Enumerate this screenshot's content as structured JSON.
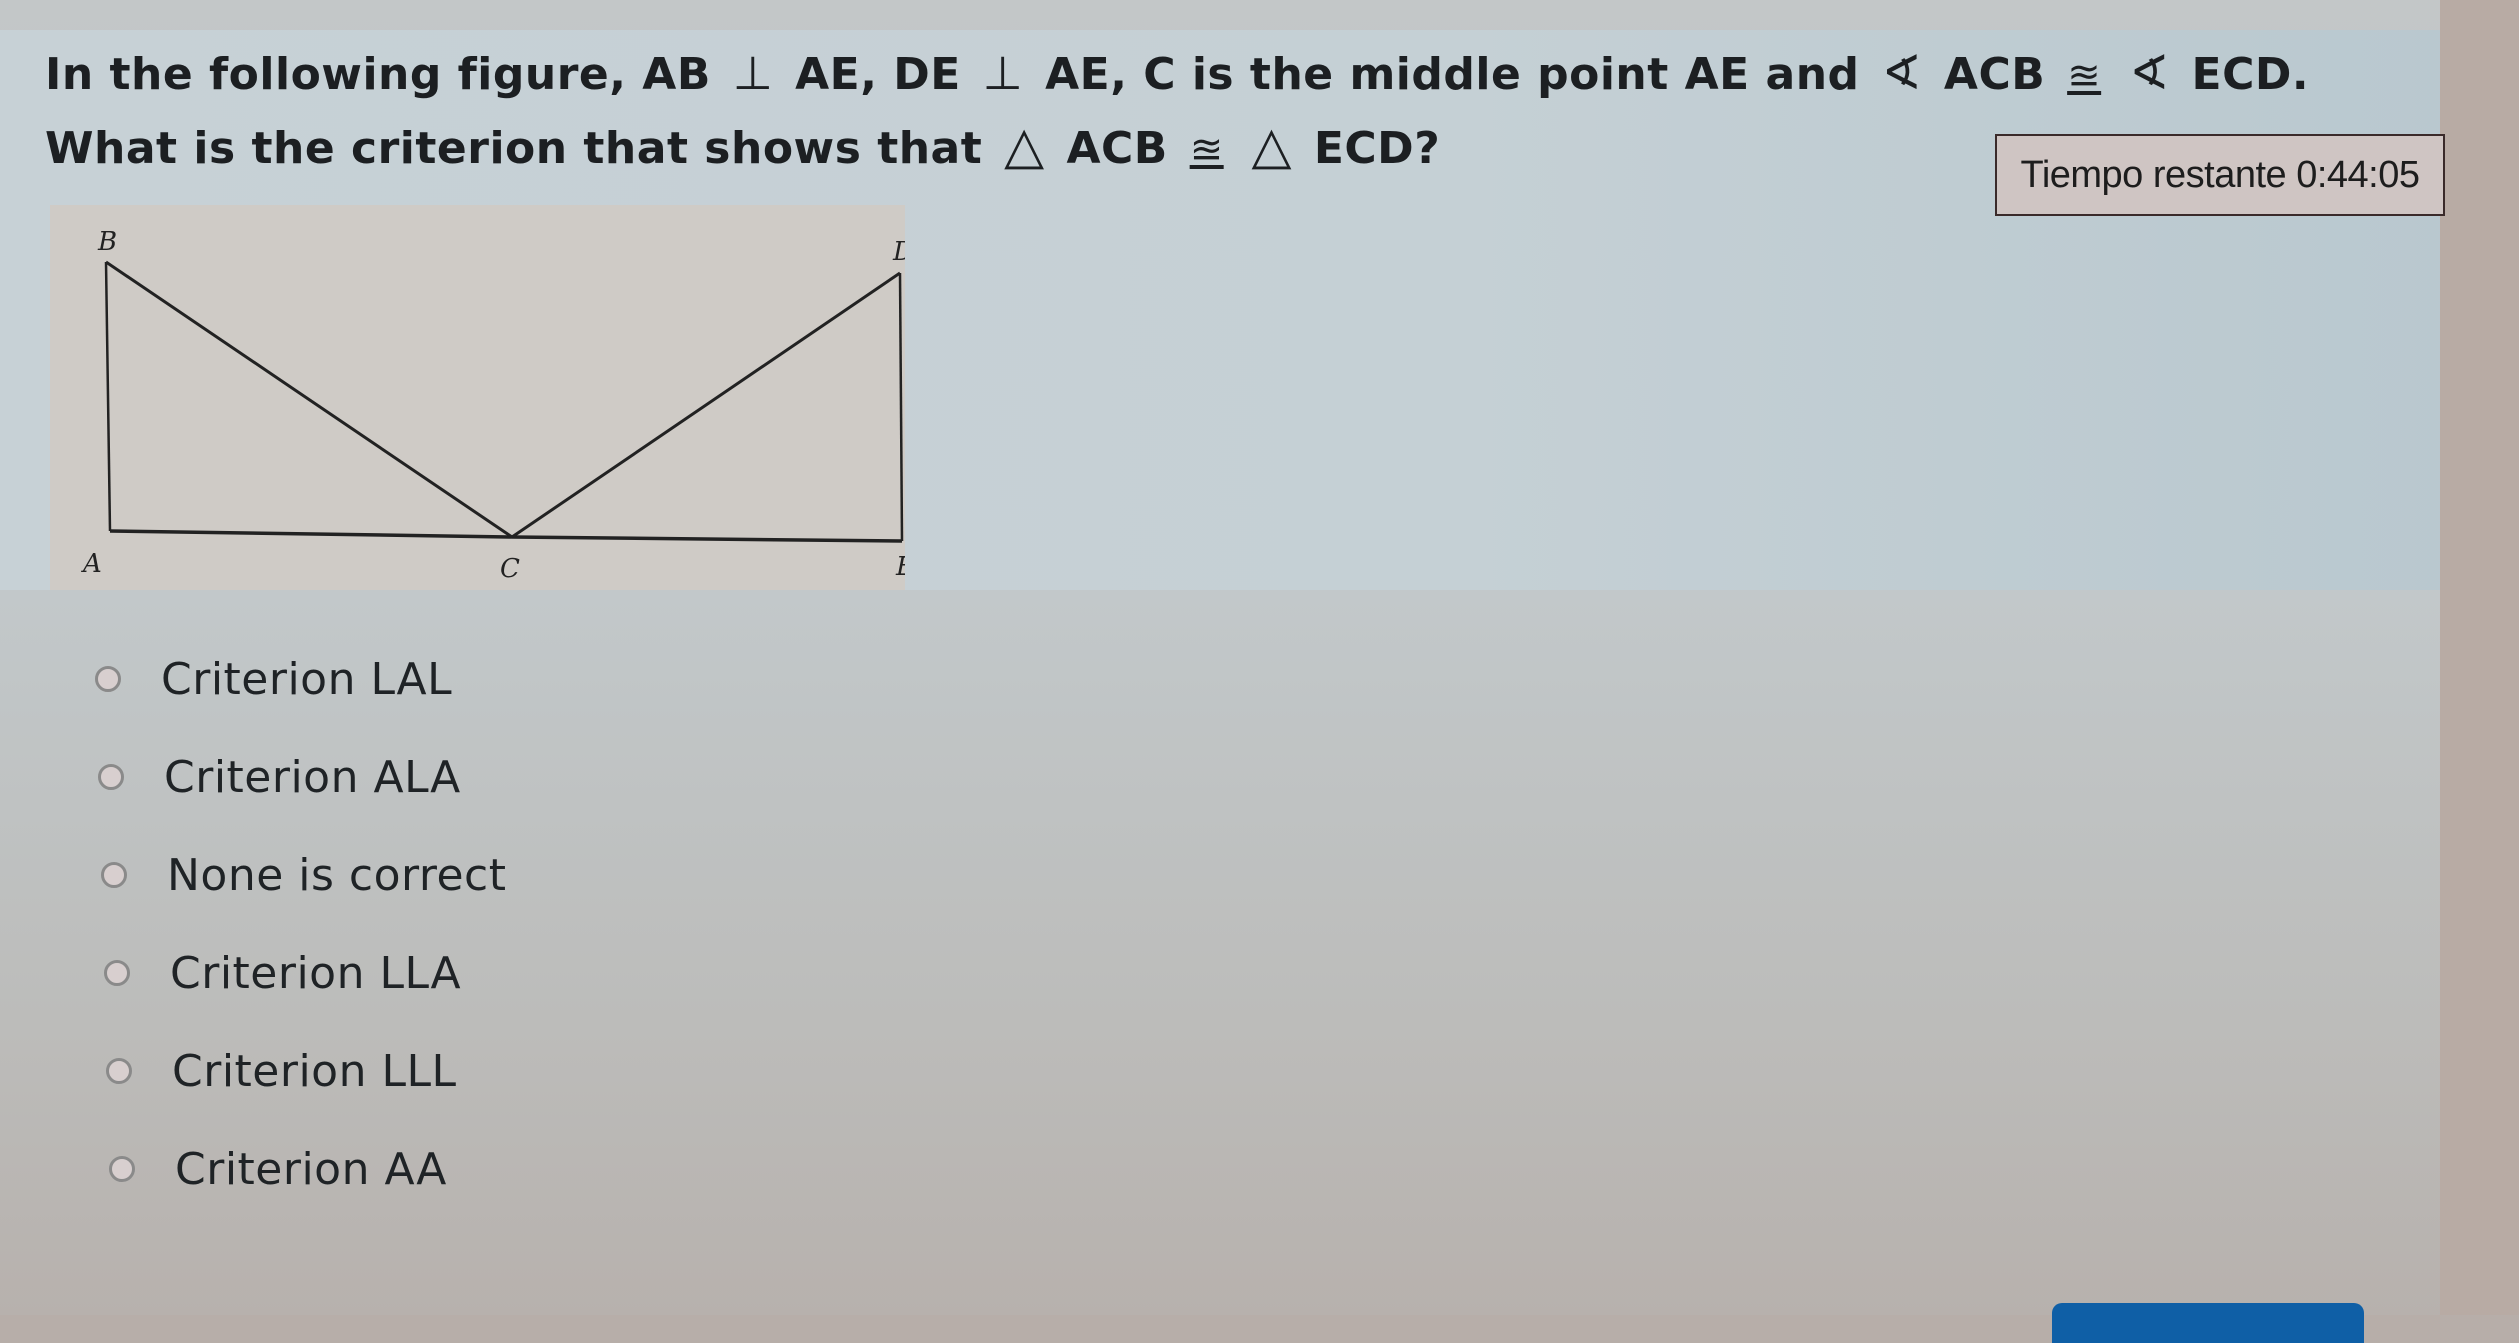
{
  "question": {
    "line1": {
      "part1": "In the following figure, AB",
      "perp1": "⊥",
      "part2": "AE, DE",
      "perp2": "⊥",
      "part3": "AE, C is the middle point AE and",
      "angle1": "∢",
      "part4": "ACB",
      "congruent1": "≊",
      "angle2": "∢",
      "part5": "ECD."
    },
    "line2": {
      "part1": "What is the criterion that shows that",
      "triangle1": "△",
      "part2": "ACB",
      "congruent": "≊",
      "triangle2": "△",
      "part3": "ECD?"
    }
  },
  "timer": {
    "label": "Tiempo restante",
    "value": "0:44:05"
  },
  "figure": {
    "labels": {
      "A": "A",
      "B": "B",
      "C": "C",
      "D": "D",
      "E": "E"
    }
  },
  "answers": [
    {
      "label": "Criterion LAL",
      "selected": false
    },
    {
      "label": "Criterion ALA",
      "selected": false
    },
    {
      "label": "None is correct",
      "selected": false
    },
    {
      "label": "Criterion LLA",
      "selected": false
    },
    {
      "label": "Criterion LLL",
      "selected": false
    },
    {
      "label": "Criterion AA",
      "selected": false
    }
  ],
  "colors": {
    "submit_button": "#0f5fa6",
    "question_panel": "#c5d0d5"
  }
}
